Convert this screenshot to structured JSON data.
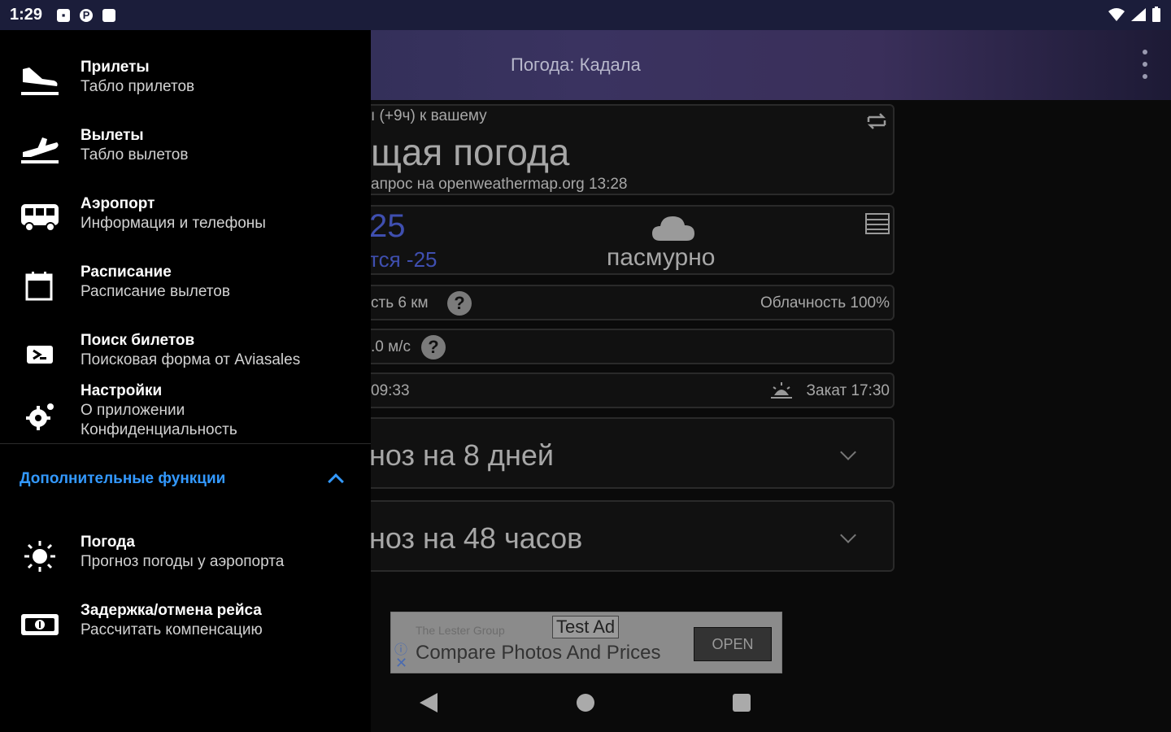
{
  "status_bar": {
    "time": "1:29"
  },
  "app_bar": {
    "title": "Погода: Кадала"
  },
  "weather": {
    "tz_note": "ı (+9ч) к вашему",
    "current_title": "щая погода",
    "request_info": "апрос на openweathermap.org 13:28",
    "temp": "25",
    "feels_like": "тся -25",
    "condition": "пасмурно",
    "visibility": "сть 6  км",
    "cloudiness": "Облачность 100%",
    "wind": ".0 м/с",
    "sunrise": "09:33",
    "sunset": "Закат 17:30",
    "forecast_8": "ноз на 8 дней",
    "forecast_48": "ноз на 48 часов"
  },
  "ad": {
    "advertiser": "The Lester Group",
    "badge": "Test Ad",
    "headline": "Compare Photos And Prices",
    "cta": "OPEN"
  },
  "drawer": {
    "items": [
      {
        "title": "Прилеты",
        "subtitle": "Табло прилетов",
        "icon": "airplane-landing-icon"
      },
      {
        "title": "Вылеты",
        "subtitle": "Табло вылетов",
        "icon": "airplane-takeoff-icon"
      },
      {
        "title": "Аэропорт",
        "subtitle": "Информация и телефоны",
        "icon": "bus-icon"
      },
      {
        "title": "Расписание",
        "subtitle": "Расписание вылетов",
        "icon": "calendar-icon"
      },
      {
        "title": "Поиск билетов",
        "subtitle": "Поисковая форма от Aviasales",
        "icon": "ticket-icon"
      }
    ],
    "settings": {
      "title": "Настройки",
      "sub1": "О приложении",
      "sub2": "Конфиденциальность"
    },
    "section_label": "Дополнительные функции",
    "extra_items": [
      {
        "title": "Погода",
        "subtitle": "Прогноз погоды у аэропорта",
        "icon": "sun-icon"
      },
      {
        "title": "Задержка/отмена рейса",
        "subtitle": "Рассчитать компенсацию",
        "icon": "money-icon"
      }
    ]
  }
}
